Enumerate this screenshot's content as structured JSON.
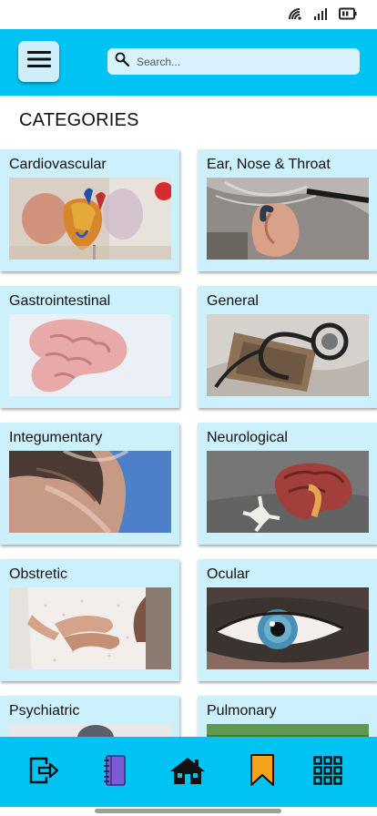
{
  "status_bar": {
    "icons": [
      "wifi-icon",
      "signal-icon",
      "battery-icon"
    ]
  },
  "header": {
    "menu_icon": "hamburger-menu-icon",
    "search": {
      "placeholder": "Search...",
      "value": ""
    }
  },
  "page_title": "CATEGORIES",
  "categories": [
    {
      "label": "Cardiovascular",
      "image": "anatomical-heart-model-photo"
    },
    {
      "label": "Ear, Nose & Throat",
      "image": "ear-hearing-aid-photo"
    },
    {
      "label": "Gastrointestinal",
      "image": "pink-intestine-model-photo"
    },
    {
      "label": "General",
      "image": "stethoscope-photo"
    },
    {
      "label": "Integumentary",
      "image": "skin-back-hair-photo"
    },
    {
      "label": "Neurological",
      "image": "brain-model-photo"
    },
    {
      "label": "Obstretic",
      "image": "hands-on-belly-photo"
    },
    {
      "label": "Ocular",
      "image": "blue-eye-photo"
    },
    {
      "label": "Psychiatric",
      "image": "person-photo"
    },
    {
      "label": "Pulmonary",
      "image": "green-photo"
    }
  ],
  "bottom_nav": {
    "items": [
      "logout-icon",
      "notebook-icon",
      "home-icon",
      "bookmark-icon",
      "grid-apps-icon"
    ]
  },
  "colors": {
    "accent": "#00c2f3",
    "card_bg": "#cdf1fc",
    "notebook": "#7b5cd6",
    "bookmark": "#f7a21b"
  }
}
